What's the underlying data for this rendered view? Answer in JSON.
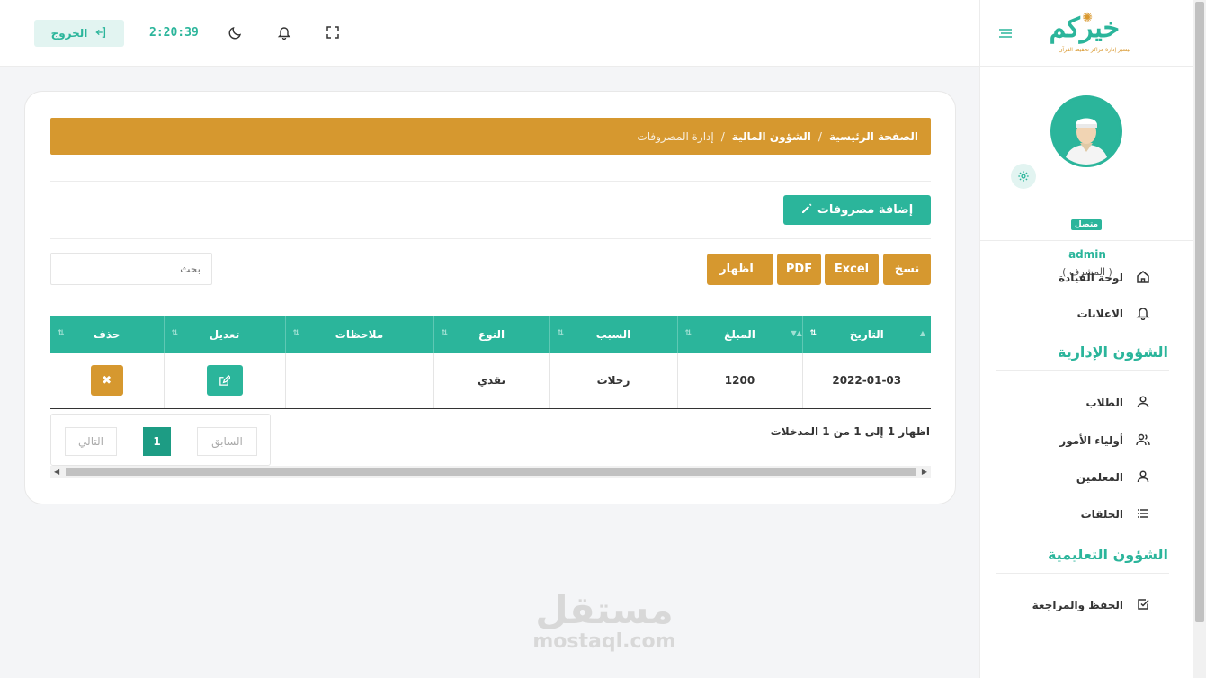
{
  "topbar": {
    "logout_label": "الخروج",
    "clock": "2:20:39",
    "icons": [
      "logout-icon",
      "moon-icon",
      "bell-icon",
      "fullscreen-icon"
    ]
  },
  "sidebar": {
    "logo_text": "خيركم",
    "logo_tagline": "تيسير إدارة مراكز تحفيظ القرآن",
    "profile": {
      "status": "متصل",
      "name": "admin",
      "role": "( المشرف )"
    },
    "nav": {
      "dashboard": "لوحة القيادة",
      "announcements": "الاعلانات",
      "section_admin": "الشؤون الإدارية",
      "students": "الطلاب",
      "guardians": "أولياء الأمور",
      "teachers": "المعلمين",
      "circles": "الحلقات",
      "section_edu": "الشؤون التعليمية",
      "memorization": "الحفظ والمراجعة"
    }
  },
  "breadcrumb": {
    "home": "الصفحة الرئيسية",
    "finance": "الشؤون المالية",
    "current": "إدارة المصروفات",
    "separator": "/"
  },
  "actions": {
    "add_expense": "إضافة مصروفات",
    "copy": "نسخ",
    "excel": "Excel",
    "pdf": "PDF",
    "show": "اظهار",
    "search_placeholder": "بحث"
  },
  "table": {
    "headers": {
      "date": "التاريخ",
      "amount": "المبلغ",
      "reason": "السبب",
      "type": "النوع",
      "notes": "ملاحظات",
      "edit": "تعديل",
      "delete": "حذف"
    },
    "rows": [
      {
        "date": "2022-01-03",
        "amount": "1200",
        "reason": "رحلات",
        "type": "نقدي",
        "notes": ""
      }
    ]
  },
  "pagination": {
    "info": "اظهار 1 إلى 1 من 1 المدخلات",
    "previous": "السابق",
    "current": "1",
    "next": "التالي"
  },
  "watermark": {
    "arabic": "مستقل",
    "latin": "mostaql.com"
  },
  "colors": {
    "primary": "#2bb59b",
    "accent": "#d6982f",
    "dark_teal": "#1d9c84"
  }
}
